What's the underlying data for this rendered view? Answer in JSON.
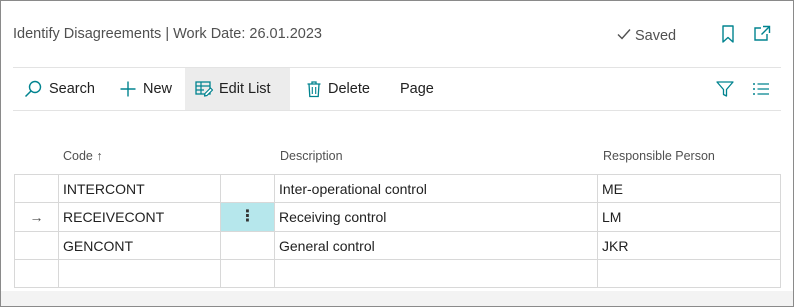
{
  "header": {
    "title": "Identify Disagreements | Work Date: 26.01.2023",
    "saved_label": "Saved",
    "icons": [
      "check-icon",
      "bookmark-icon",
      "open-in-new-window-icon"
    ]
  },
  "toolbar": {
    "search_label": "Search",
    "new_label": "New",
    "edit_list_label": "Edit List",
    "delete_label": "Delete",
    "page_label": "Page",
    "icons": [
      "search-icon",
      "plus-icon",
      "edit-list-icon",
      "trash-icon",
      "filter-icon",
      "list-view-icon"
    ]
  },
  "grid": {
    "columns": {
      "code": "Code",
      "sort_indicator": "↑",
      "description": "Description",
      "responsible_person": "Responsible Person"
    },
    "rows": [
      {
        "code": "INTERCONT",
        "description": "Inter-operational control",
        "responsible_person": "ME",
        "current": false,
        "indicator": ""
      },
      {
        "code": "RECEIVECONT",
        "description": "Receiving control",
        "responsible_person": "LM",
        "current": true,
        "indicator": "→"
      },
      {
        "code": "GENCONT",
        "description": "General control",
        "responsible_person": "JKR",
        "current": false,
        "indicator": ""
      },
      {
        "code": "",
        "description": "",
        "responsible_person": "",
        "current": false,
        "indicator": ""
      }
    ],
    "row_menu_glyph": "⋮"
  },
  "colors": {
    "accent": "#00838f",
    "selected_cell": "#b6e7ec",
    "active_button_bg": "#ececec"
  }
}
